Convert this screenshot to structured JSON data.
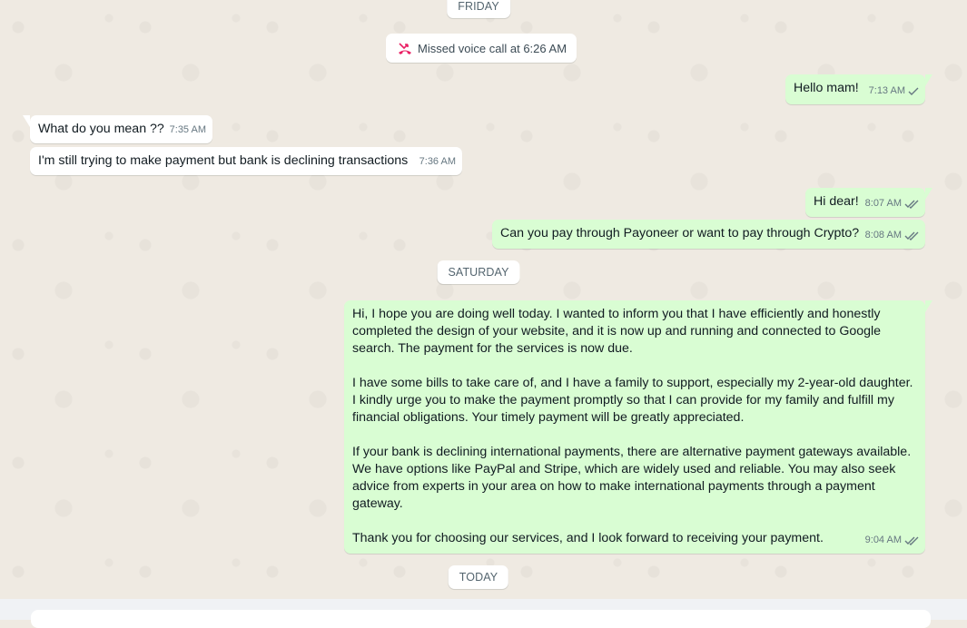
{
  "dates": {
    "friday": "FRIDAY",
    "saturday": "SATURDAY",
    "today": "TODAY"
  },
  "system": {
    "missed_call": "Missed voice call at 6:26 AM",
    "icon": "missed-call-icon",
    "icon_color": "#e91e63"
  },
  "messages": [
    {
      "dir": "out",
      "text": "Hello mam!",
      "time": "7:13 AM",
      "status": "sent"
    },
    {
      "dir": "in",
      "text": "What do you mean ??",
      "time": "7:35 AM"
    },
    {
      "dir": "in",
      "text": "I'm still trying to make payment but bank is declining transactions",
      "time": "7:36 AM"
    },
    {
      "dir": "out",
      "text": "Hi dear!",
      "time": "8:07 AM",
      "status": "delivered"
    },
    {
      "dir": "out",
      "text": "Can you pay through Payoneer or want to pay through Crypto?",
      "time": "8:08 AM",
      "status": "delivered"
    },
    {
      "dir": "out",
      "paragraphs": [
        "Hi, I hope you are doing well today. I wanted to inform you that I have efficiently and honestly completed the design of your website, and it is now up and running and connected to Google search. The payment for the services is now due.",
        "I have some bills to take care of, and I have a family to support, especially my 2-year-old daughter. I kindly urge you to make the payment promptly so that I can provide for my family and fulfill my financial obligations. Your timely payment will be greatly appreciated.",
        "If your bank is declining international payments, there are alternative payment gateways available. We have options like PayPal and Stripe, which are widely used and reliable. You may also seek advice from experts in your area on how to make international payments through a payment gateway.",
        "Thank you for choosing our services, and I look forward to receiving your payment."
      ],
      "time": "9:04 AM",
      "status": "delivered"
    }
  ],
  "colors": {
    "outgoing_bubble": "#d9fdd3",
    "incoming_bubble": "#ffffff",
    "chat_background": "#efeae2",
    "meta_text": "#667781"
  }
}
